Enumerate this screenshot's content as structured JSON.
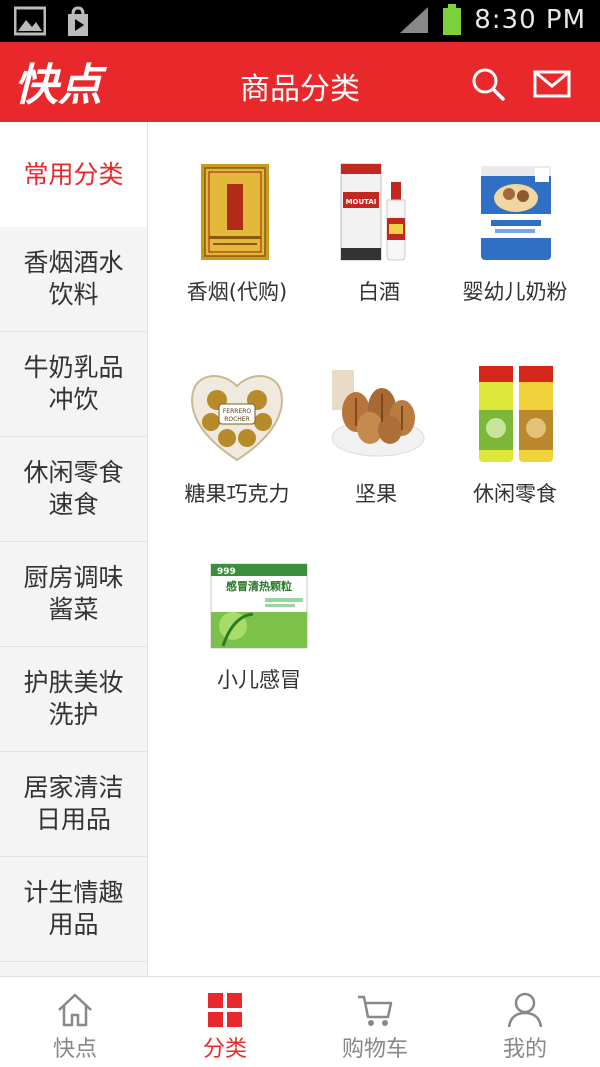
{
  "status_bar": {
    "time": "8:30 PM"
  },
  "header": {
    "logo_text": "快点",
    "title": "商品分类"
  },
  "sidebar": {
    "items": [
      {
        "label": "常用分类",
        "active": true
      },
      {
        "label": "香烟酒水饮料",
        "line1": "香烟酒水",
        "line2": "饮料"
      },
      {
        "label": "牛奶乳品冲饮",
        "line1": "牛奶乳品",
        "line2": "冲饮"
      },
      {
        "label": "休闲零食速食",
        "line1": "休闲零食",
        "line2": "速食"
      },
      {
        "label": "厨房调味酱菜",
        "line1": "厨房调味",
        "line2": "酱菜"
      },
      {
        "label": "护肤美妆洗护",
        "line1": "护肤美妆",
        "line2": "洗护"
      },
      {
        "label": "居家清洁日用品",
        "line1": "居家清洁",
        "line2": "日用品"
      },
      {
        "label": "计生情趣用品",
        "line1": "计生情趣",
        "line2": "用品"
      }
    ]
  },
  "categories": [
    {
      "label": "香烟(代购)",
      "icon": "cigarette-pack-icon"
    },
    {
      "label": "白酒",
      "icon": "moutai-bottle-icon"
    },
    {
      "label": "婴幼儿奶粉",
      "icon": "milk-powder-can-icon"
    },
    {
      "label": "糖果巧克力",
      "icon": "chocolate-box-icon"
    },
    {
      "label": "坚果",
      "icon": "nuts-bowl-icon"
    },
    {
      "label": "休闲零食",
      "icon": "chips-can-icon"
    },
    {
      "label": "小儿感冒",
      "icon": "medicine-box-icon"
    }
  ],
  "product_text": {
    "moutai": "MOUTAI",
    "ferrero": "FERRERO",
    "rocher": "ROCHER",
    "medicine": "感冒清热颗粒",
    "brand999": "999"
  },
  "bottom_nav": [
    {
      "label": "快点",
      "icon": "home-icon"
    },
    {
      "label": "分类",
      "icon": "grid-icon",
      "active": true
    },
    {
      "label": "购物车",
      "icon": "cart-icon"
    },
    {
      "label": "我的",
      "icon": "user-icon"
    }
  ],
  "colors": {
    "brand_red": "#e8282a",
    "sidebar_bg": "#f4f4f4"
  }
}
